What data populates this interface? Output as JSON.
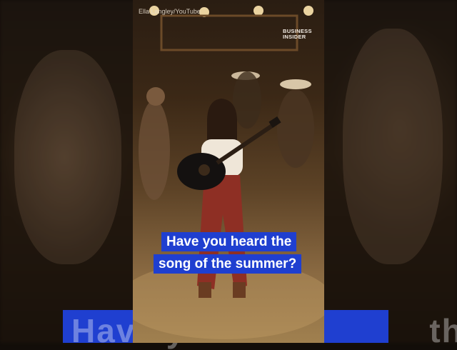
{
  "source_credit": "Ella Langley/YouTube",
  "logo": {
    "line1": "BUSINESS",
    "line2": "INSIDER"
  },
  "caption": {
    "line1": "Have you heard the",
    "line2": "song of the summer?"
  },
  "background_caption_fragment": "Have you                   the",
  "colors": {
    "caption_bg": "#1f3fd0",
    "caption_text": "#ffffff"
  }
}
